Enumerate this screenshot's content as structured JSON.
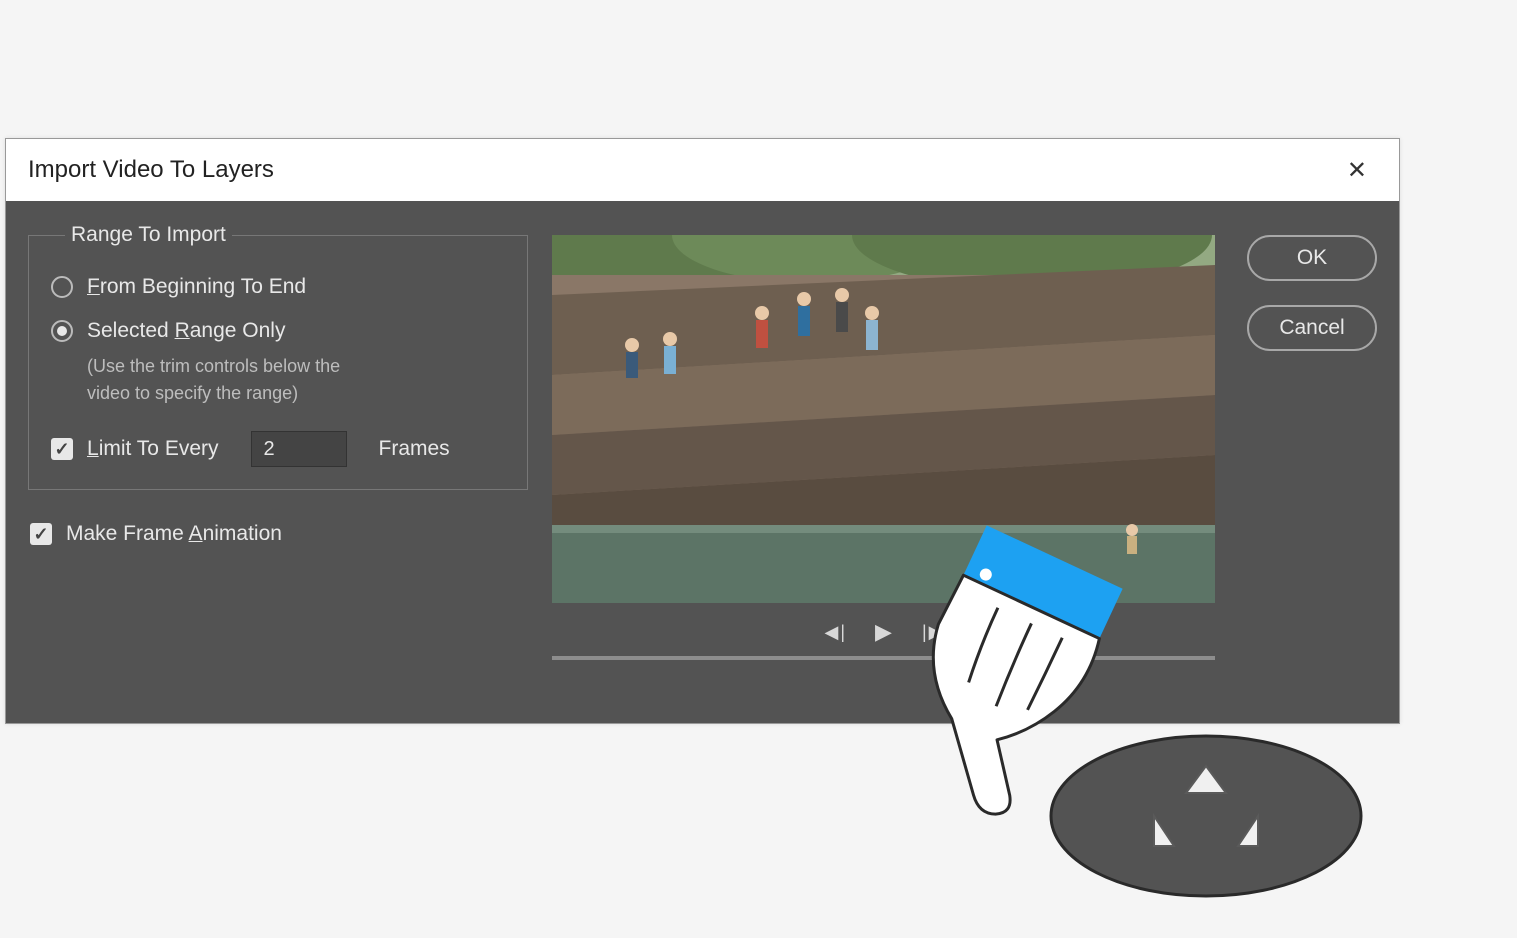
{
  "dialog": {
    "title": "Import Video To Layers",
    "close_symbol": "✕"
  },
  "range": {
    "legend": "Range To Import",
    "from_beginning": "From Beginning To End",
    "selected_range": "Selected Range Only",
    "selected_range_hint_l1": "(Use the trim controls below the",
    "selected_range_hint_l2": "video to specify the range)",
    "limit_label": "Limit To Every",
    "limit_value": "2",
    "frames_label": "Frames",
    "selected_option": "selected_range",
    "limit_checked": true
  },
  "make_animation": {
    "label": "Make Frame Animation",
    "checked": true
  },
  "buttons": {
    "ok": "OK",
    "cancel": "Cancel"
  },
  "transport": {
    "prev": "◀",
    "prev_bar": "|",
    "play": "▶",
    "next_bar": "|",
    "next": "▶"
  }
}
